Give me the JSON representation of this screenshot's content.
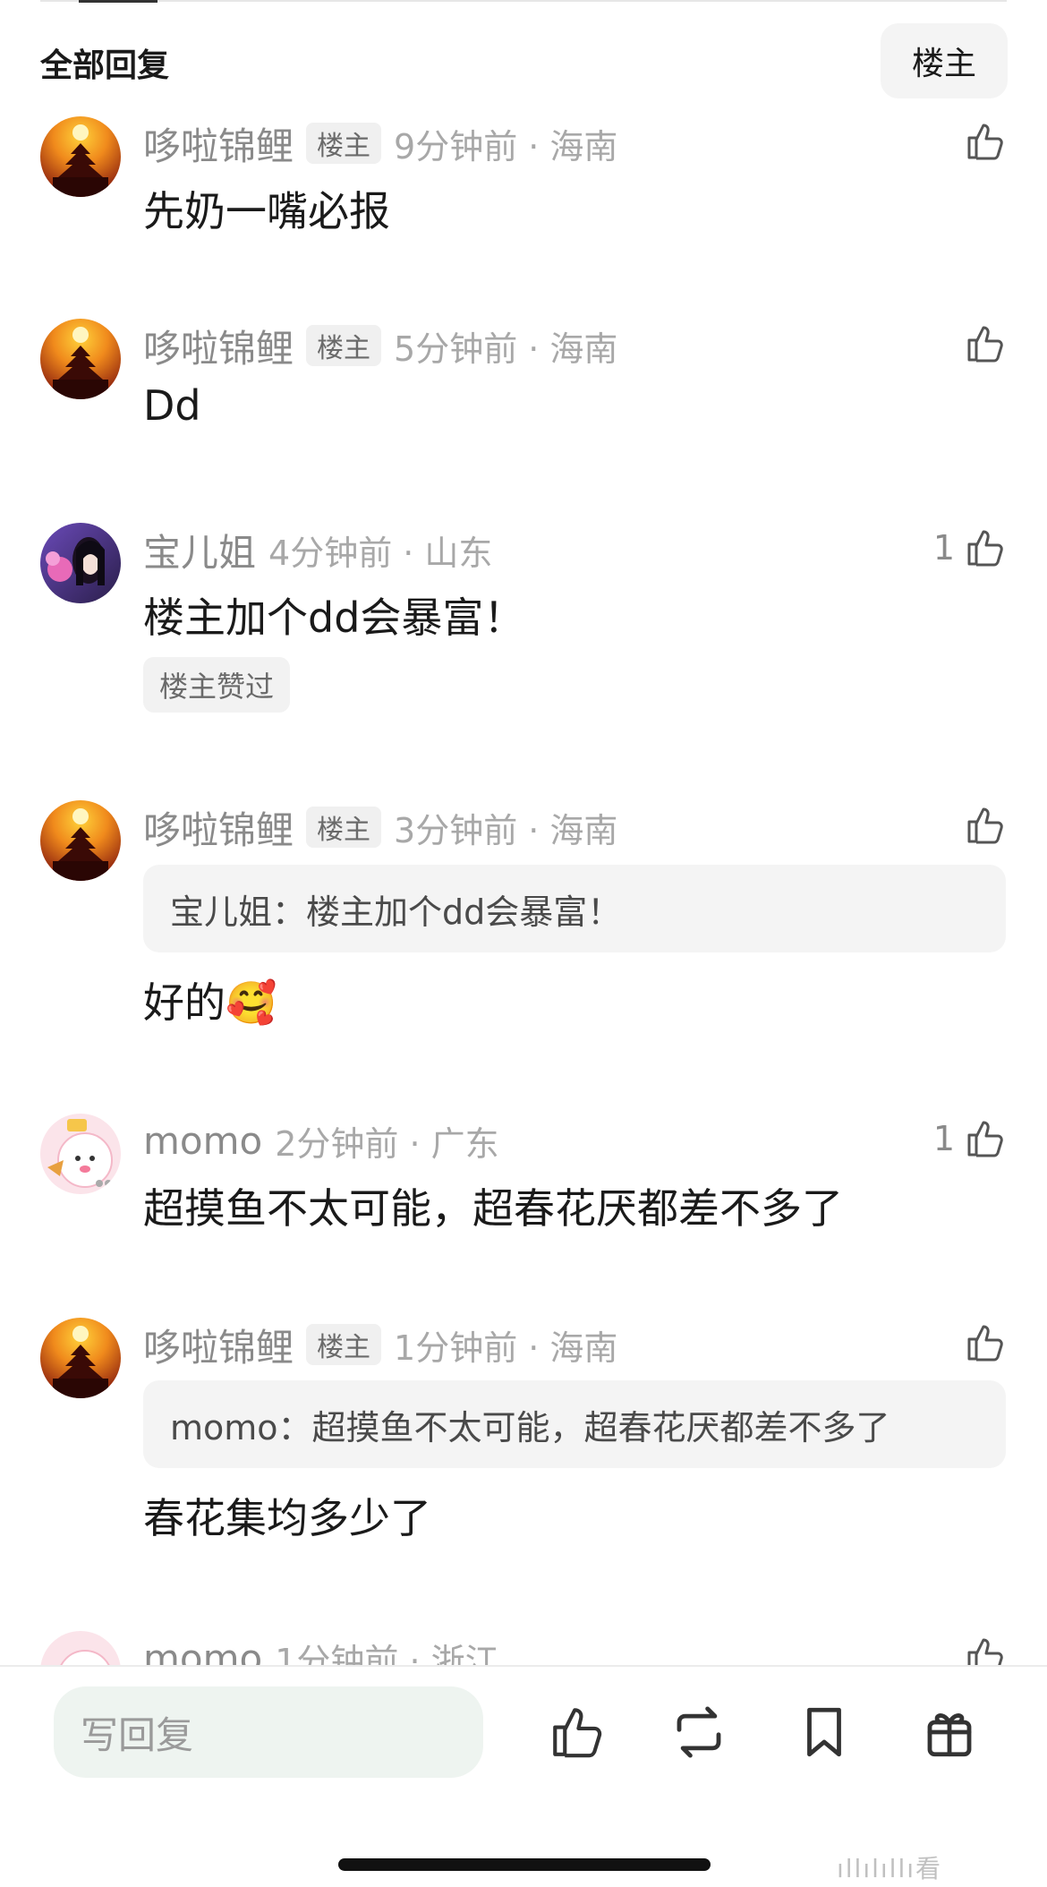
{
  "header": {
    "title": "全部回复",
    "filter_label": "楼主"
  },
  "comments": [
    {
      "username": "哆啦锦鲤",
      "badge": "楼主",
      "meta": "9分钟前 · 海南",
      "likes": "",
      "text": "先奶一嘴必报",
      "avatar": "pagoda-sunset"
    },
    {
      "username": "哆啦锦鲤",
      "badge": "楼主",
      "meta": "5分钟前 · 海南",
      "likes": "",
      "text": "Dd",
      "avatar": "pagoda-sunset"
    },
    {
      "username": "宝儿姐",
      "badge": "",
      "meta": "4分钟前 · 山东",
      "likes": "1",
      "text": "楼主加个dd会暴富！",
      "liked_badge": "楼主赞过",
      "avatar": "anime-girl"
    },
    {
      "username": "哆啦锦鲤",
      "badge": "楼主",
      "meta": "3分钟前 · 海南",
      "likes": "",
      "quote": "宝儿姐：楼主加个dd会暴富！",
      "text": "好的🥰",
      "avatar": "pagoda-sunset"
    },
    {
      "username": "momo",
      "badge": "",
      "meta": "2分钟前 · 广东",
      "likes": "1",
      "text": "超摸鱼不太可能，超春花厌都差不多了",
      "avatar": "cartoon-pink"
    },
    {
      "username": "哆啦锦鲤",
      "badge": "楼主",
      "meta": "1分钟前 · 海南",
      "likes": "",
      "quote": "momo：超摸鱼不太可能，超春花厌都差不多了",
      "text": "春花集均多少了",
      "avatar": "pagoda-sunset"
    },
    {
      "username": "momo",
      "badge": "",
      "meta": "1分钟前 · 浙江",
      "likes": "",
      "text": "",
      "avatar": "cartoon-pink"
    }
  ],
  "bottom_bar": {
    "reply_placeholder": "写回复",
    "icons": [
      "thumbs-up-icon",
      "repost-icon",
      "bookmark-icon",
      "gift-icon"
    ]
  },
  "watermark": "ıllılıllı看"
}
